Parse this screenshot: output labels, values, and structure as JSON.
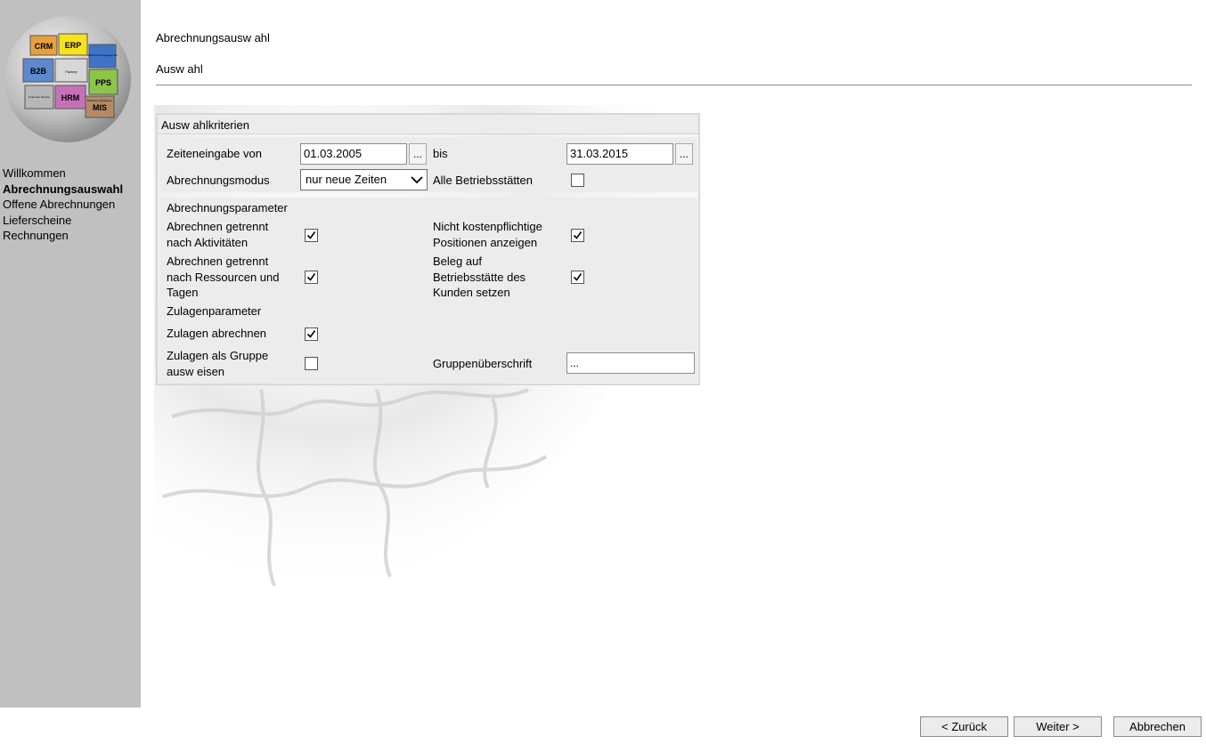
{
  "header": {
    "page_title": "Abrechnungsausw ahl",
    "section_title": "Ausw ahl"
  },
  "logo": {
    "pieces": [
      "CRM",
      "ERP",
      "B2B",
      "PPS",
      "HRM",
      "MIS"
    ],
    "small_labels": [
      "Factory",
      "Warehouse Management",
      "Customer Service",
      "Business Intelligence"
    ]
  },
  "sidebar": {
    "items": [
      {
        "label": "Willkommen",
        "active": false
      },
      {
        "label": "Abrechnungsauswahl",
        "active": true
      },
      {
        "label": "Offene Abrechnungen",
        "active": false
      },
      {
        "label": "Lieferscheine",
        "active": false
      },
      {
        "label": "Rechnungen",
        "active": false
      }
    ]
  },
  "panel": {
    "title": "Ausw ahlkriterien",
    "zeiteingabe_label": "Zeiteneingabe von",
    "date_from": "01.03.2005",
    "bis_label": "bis",
    "date_to": "31.03.2015",
    "dots": "...",
    "modus_label": "Abrechnungsmodus",
    "modus_value": "nur neue Zeiten",
    "alle_label": "Alle Betriebsstätten",
    "alle_checked": false,
    "parameter_title": "Abrechnungsparameter",
    "aktivitaeten_label": "Abrechnen getrennt\nnach Aktivitäten",
    "aktivitaeten_checked": true,
    "nicht_kosten_label": "Nicht kostenpflichtige\nPositionen anzeigen",
    "nicht_kosten_checked": true,
    "ressourcen_label": "Abrechnen getrennt\nnach Ressourcen und\nTagen",
    "ressourcen_checked": true,
    "beleg_label": "Beleg auf\nBetriebsstätte des\nKunden setzen",
    "beleg_checked": true,
    "zulagen_title": "Zulagenparameter",
    "zulagen_label": "Zulagen abrechnen",
    "zulagen_checked": true,
    "gruppe_label": "Zulagen als Gruppe\nausw eisen",
    "gruppe_checked": false,
    "ueberschrift_label": "Gruppenüberschrift",
    "ueberschrift_value": "..."
  },
  "buttons": {
    "back": "< Zurück",
    "next": "Weiter >",
    "cancel": "Abbrechen"
  },
  "colors": {
    "sidebar_bg": "#c0c0c0",
    "panel_bg": "#ececec"
  }
}
